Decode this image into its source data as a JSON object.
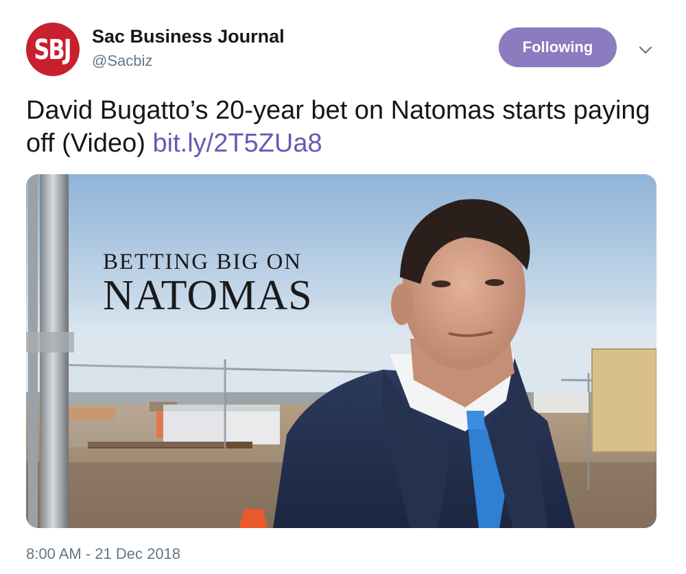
{
  "account": {
    "avatar_text": "SBJ",
    "display_name": "Sac Business Journal",
    "handle": "@Sacbiz"
  },
  "follow_button": {
    "label": "Following",
    "color": "#8b7bbf"
  },
  "menu": {
    "icon": "chevron-down-icon"
  },
  "tweet": {
    "text": "David Bugatto’s 20-year bet on Natomas starts paying off (Video) ",
    "link_text": "bit.ly/2T5ZUa8",
    "link_color": "#6b57b5"
  },
  "media": {
    "headline_line1": "BETTING BIG ON",
    "headline_line2": "NATOMAS"
  },
  "timestamp": "8:00 AM - 21 Dec 2018"
}
